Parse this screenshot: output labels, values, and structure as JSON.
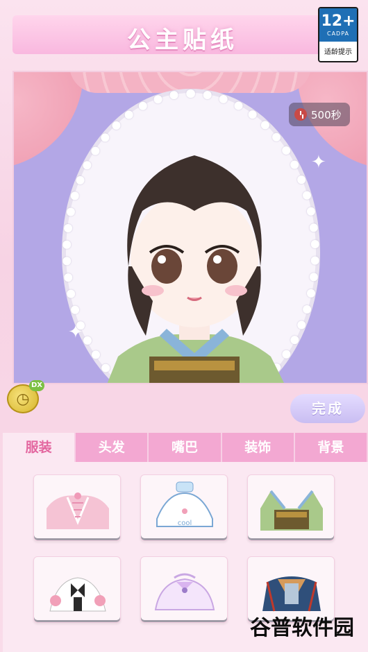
{
  "header": {
    "title": "公主贴纸"
  },
  "age_rating": {
    "label": "12+",
    "org": "CADPA",
    "tip": "适龄提示"
  },
  "timer": {
    "value": "500秒"
  },
  "coin": {
    "badge": "DX"
  },
  "actions": {
    "done_label": "完成"
  },
  "tabs": [
    {
      "label": "服装",
      "active": true
    },
    {
      "label": "头发",
      "active": false
    },
    {
      "label": "嘴巴",
      "active": false
    },
    {
      "label": "装饰",
      "active": false
    },
    {
      "label": "背景",
      "active": false
    }
  ],
  "items": [
    {
      "name": "pink-corset-outfit"
    },
    {
      "name": "cool-top-outfit",
      "text": "cool"
    },
    {
      "name": "green-hanfu-outfit"
    },
    {
      "name": "maid-outfit"
    },
    {
      "name": "lilac-blouse-outfit"
    },
    {
      "name": "blue-armor-outfit"
    }
  ],
  "watermark": {
    "text": "谷普软件园"
  },
  "colors": {
    "accent": "#f3a8d2",
    "stage_bg": "#b3a7e6",
    "active_tab_text": "#e3669f"
  }
}
